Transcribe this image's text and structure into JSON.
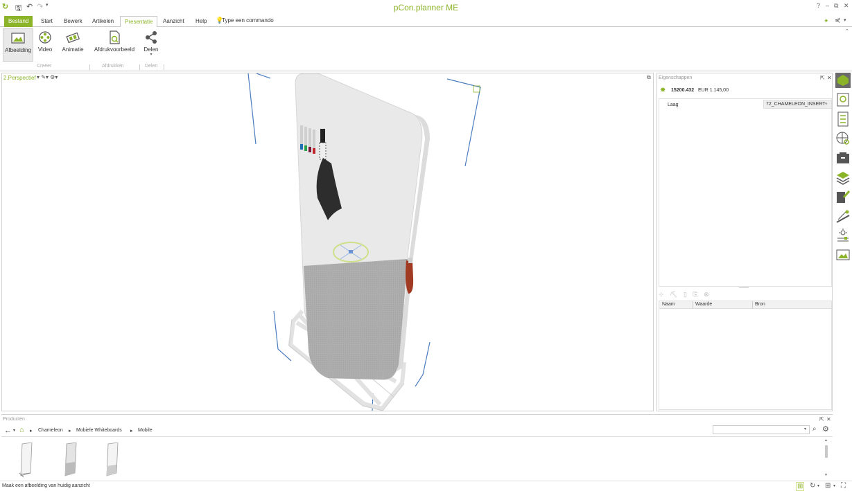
{
  "app": {
    "title": "pCon.planner ME"
  },
  "window_controls": {
    "help": "?",
    "minimize": "–",
    "restore": "⧉",
    "close": "✕"
  },
  "menu": {
    "tabs": [
      "Bestand",
      "Start",
      "Bewerk",
      "Artikelen",
      "Presentatie",
      "Aanzicht",
      "Help"
    ],
    "command_placeholder": "Type een commando"
  },
  "ribbon": {
    "buttons": [
      "Afbeelding",
      "Video",
      "Animatie",
      "Afdrukvoorbeeld",
      "Delen"
    ],
    "groups": [
      "Creëer",
      "Afdrukken",
      "Delen"
    ]
  },
  "viewport": {
    "label": "2.Perspectief"
  },
  "properties": {
    "title": "Eigenschappen",
    "article_number": "15200.432",
    "price": "EUR 1.145,00",
    "layer_label": "Laag",
    "layer_value": "72_CHAMELEON_INSERT",
    "columns": [
      "Naam",
      "Waarde",
      "Bron"
    ]
  },
  "products": {
    "title": "Producten",
    "breadcrumb": [
      "Chameleon",
      "Mobiele Whiteboards",
      "Mobile"
    ]
  },
  "status": {
    "text": "Maak een afbeelding van huidig aanzicht"
  },
  "colors": {
    "accent": "#8cb428",
    "border": "#d0d0d0",
    "guide_lines": "#4a7cc0"
  }
}
